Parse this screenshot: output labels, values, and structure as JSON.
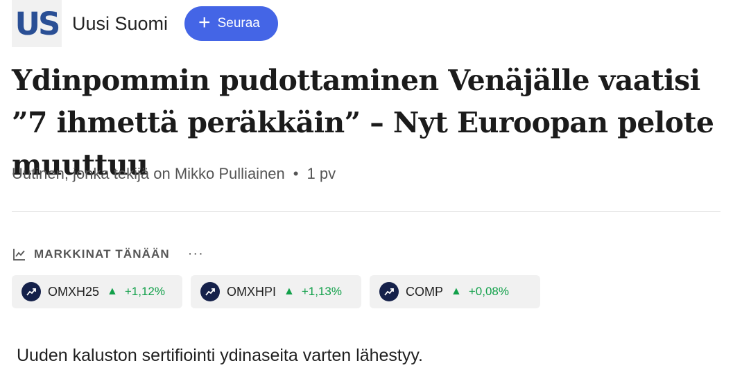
{
  "publisher": {
    "logo_text": "US",
    "name": "Uusi Suomi"
  },
  "follow_button": {
    "icon": "plus-icon",
    "label": "Seuraa"
  },
  "article": {
    "title": "Ydinpommin pudottaminen Venäjälle vaatisi ”7 ihmettä peräkkäin” – Nyt Euroopan pelote muuttuu",
    "byline": "Uutinen, jonka tekijä on Mikko Pulliainen",
    "separator": "•",
    "time": "1 pv",
    "lead": "Uuden kaluston sertifiointi ydinaseita varten lähestyy."
  },
  "markets": {
    "icon": "chart-line-icon",
    "title": "MARKKINAT TÄNÄÄN",
    "more_label": "···",
    "tickers": [
      {
        "symbol": "OMXH25",
        "arrow": "▲",
        "change": "+1,12%"
      },
      {
        "symbol": "OMXHPI",
        "arrow": "▲",
        "change": "+1,13%"
      },
      {
        "symbol": "COMP",
        "arrow": "▲",
        "change": "+0,08%"
      }
    ]
  },
  "colors": {
    "accent": "#4465e6",
    "positive": "#12a04a",
    "logo_blue": "#2a4f95",
    "ticker_icon_bg": "#15214a"
  }
}
